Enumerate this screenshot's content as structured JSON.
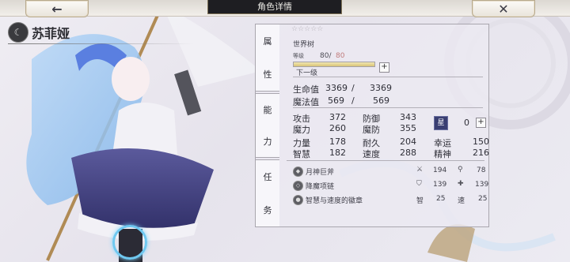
{
  "header": {
    "back_icon": "arrow-left-icon",
    "close_icon": "close-icon",
    "title": "角色详情"
  },
  "character": {
    "name": "苏菲娅",
    "emblem_icon": "moon-emblem-icon"
  },
  "tabs": {
    "attributes": [
      "属",
      "性"
    ],
    "ability": [
      "能",
      "力"
    ],
    "task": [
      "任",
      "务"
    ]
  },
  "profile": {
    "stars": "☆☆☆☆☆",
    "class_name": "世界树",
    "level_label": "等级",
    "level_current": "80/",
    "level_max": "80",
    "level_fill": 1.0,
    "next_level_label": "下一级"
  },
  "vitals": [
    {
      "label": "生命值",
      "current": "3369",
      "sep": "/",
      "max": "3369"
    },
    {
      "label": "魔法值",
      "current": "569",
      "sep": "/",
      "max": "569"
    }
  ],
  "stats": [
    {
      "label": "攻击",
      "value": "372"
    },
    {
      "label": "防御",
      "value": "343"
    },
    {
      "label": "魔力",
      "value": "260"
    },
    {
      "label": "魔防",
      "value": "355"
    },
    {
      "label": "力量",
      "value": "178"
    },
    {
      "label": "耐久",
      "value": "204"
    },
    {
      "label": "幸运",
      "value": "150"
    },
    {
      "label": "智慧",
      "value": "182"
    },
    {
      "label": "速度",
      "value": "288"
    },
    {
      "label": "精神",
      "value": "216"
    }
  ],
  "points": {
    "icon": "stat-token-icon",
    "value": "0"
  },
  "equipment": [
    {
      "name": "月神巨斧",
      "icon_a": "sword-icon",
      "value_a": "194",
      "icon_b": "staff-icon",
      "value_b": "78"
    },
    {
      "name": "降魔项链",
      "icon_a": "shield-icon",
      "value_a": "139",
      "icon_b": "cross-icon",
      "value_b": "139"
    },
    {
      "name": "智慧与速度的徽章",
      "icon_a": "智",
      "value_a": "25",
      "icon_b": "速",
      "value_b": "25"
    }
  ]
}
